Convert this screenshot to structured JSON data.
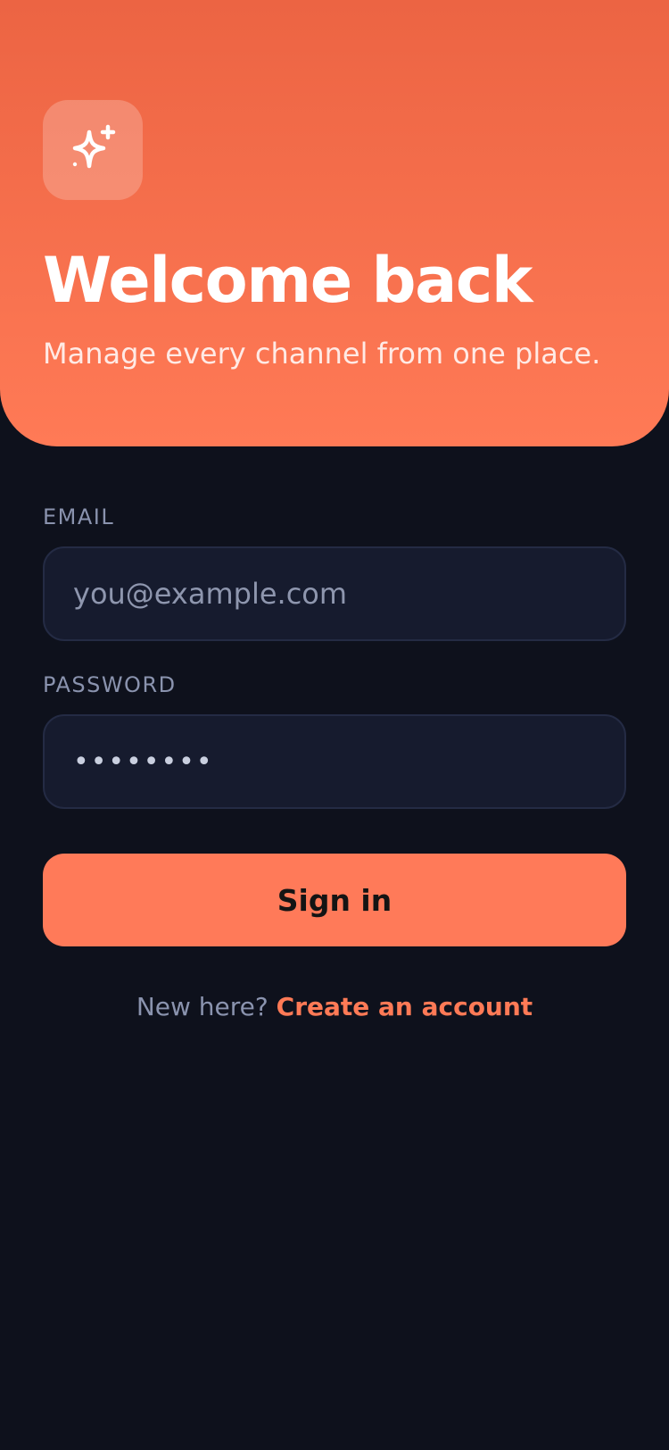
{
  "hero": {
    "title": "Welcome back",
    "subtitle": "Manage every channel from one place.",
    "logo_icon": "sparkle-icon",
    "gradient_top": "#ec6443",
    "gradient_bottom": "#ff7a56"
  },
  "form": {
    "email": {
      "label": "EMAIL",
      "placeholder": "you@example.com",
      "value": ""
    },
    "password": {
      "label": "PASSWORD",
      "value": "••••••••"
    },
    "submit_label": "Sign in"
  },
  "signup": {
    "prompt": "New here?",
    "link_label": "Create an account"
  },
  "colors": {
    "background": "#0e111c",
    "accent": "#ff7a59",
    "field_background": "#161b2e",
    "muted_text": "#8a93ae"
  }
}
